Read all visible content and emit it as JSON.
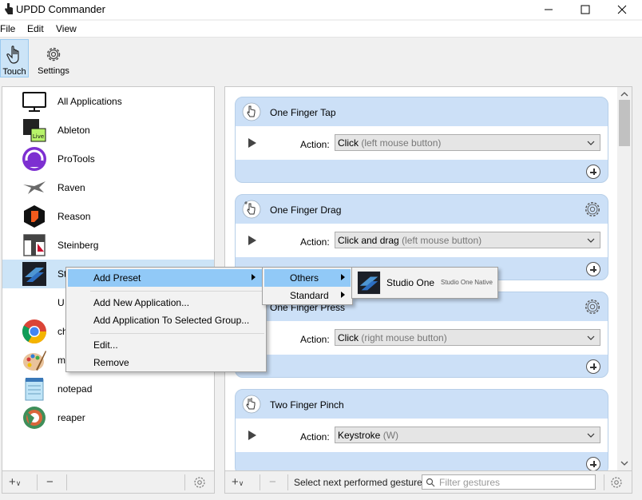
{
  "window": {
    "title": "UPDD Commander"
  },
  "menubar": {
    "items": [
      "File",
      "Edit",
      "View"
    ]
  },
  "toolbar": {
    "touch_label": "Touch",
    "settings_label": "Settings"
  },
  "apps": [
    {
      "name": "All Applications",
      "icon": "monitor-icon"
    },
    {
      "name": "Ableton",
      "icon": "ableton-icon"
    },
    {
      "name": "ProTools",
      "icon": "protools-icon"
    },
    {
      "name": "Raven",
      "icon": "raven-icon"
    },
    {
      "name": "Reason",
      "icon": "reason-icon"
    },
    {
      "name": "Steinberg",
      "icon": "steinberg-icon"
    },
    {
      "name": "St",
      "icon": "studio-one-icon"
    },
    {
      "name": "U",
      "icon": ""
    },
    {
      "name": "ch",
      "icon": "chrome-icon"
    },
    {
      "name": "m",
      "icon": "paint-icon"
    },
    {
      "name": "notepad",
      "icon": "notepad-icon"
    },
    {
      "name": "reaper",
      "icon": "reaper-icon"
    }
  ],
  "gestures": [
    {
      "name": "One Finger Tap",
      "action_label": "Action:",
      "value": "Click",
      "hint": "(left mouse button)"
    },
    {
      "name": "One Finger Drag",
      "action_label": "Action:",
      "value": "Click and drag",
      "hint": "(left mouse button)"
    },
    {
      "name": "One Finger Press",
      "action_label": "Action:",
      "value": "Click",
      "hint": "(right mouse button)"
    },
    {
      "name": "Two Finger Pinch",
      "action_label": "Action:",
      "value": "Keystroke",
      "hint": "(W)"
    }
  ],
  "right_bottom": {
    "select_next": "Select next performed gesture",
    "filter_placeholder": "Filter gestures"
  },
  "context_menu": {
    "items": [
      "Add Preset",
      "Add New Application...",
      "Add Application To Selected Group...",
      "Edit...",
      "Remove"
    ]
  },
  "submenu": {
    "items": [
      "Others",
      "Standard"
    ]
  },
  "preset_menu": {
    "name": "Studio One",
    "detail": "Studio One Native"
  },
  "colors": {
    "highlight": "#91c9f7",
    "card": "#cce0f7",
    "selected": "#cce4f7"
  }
}
